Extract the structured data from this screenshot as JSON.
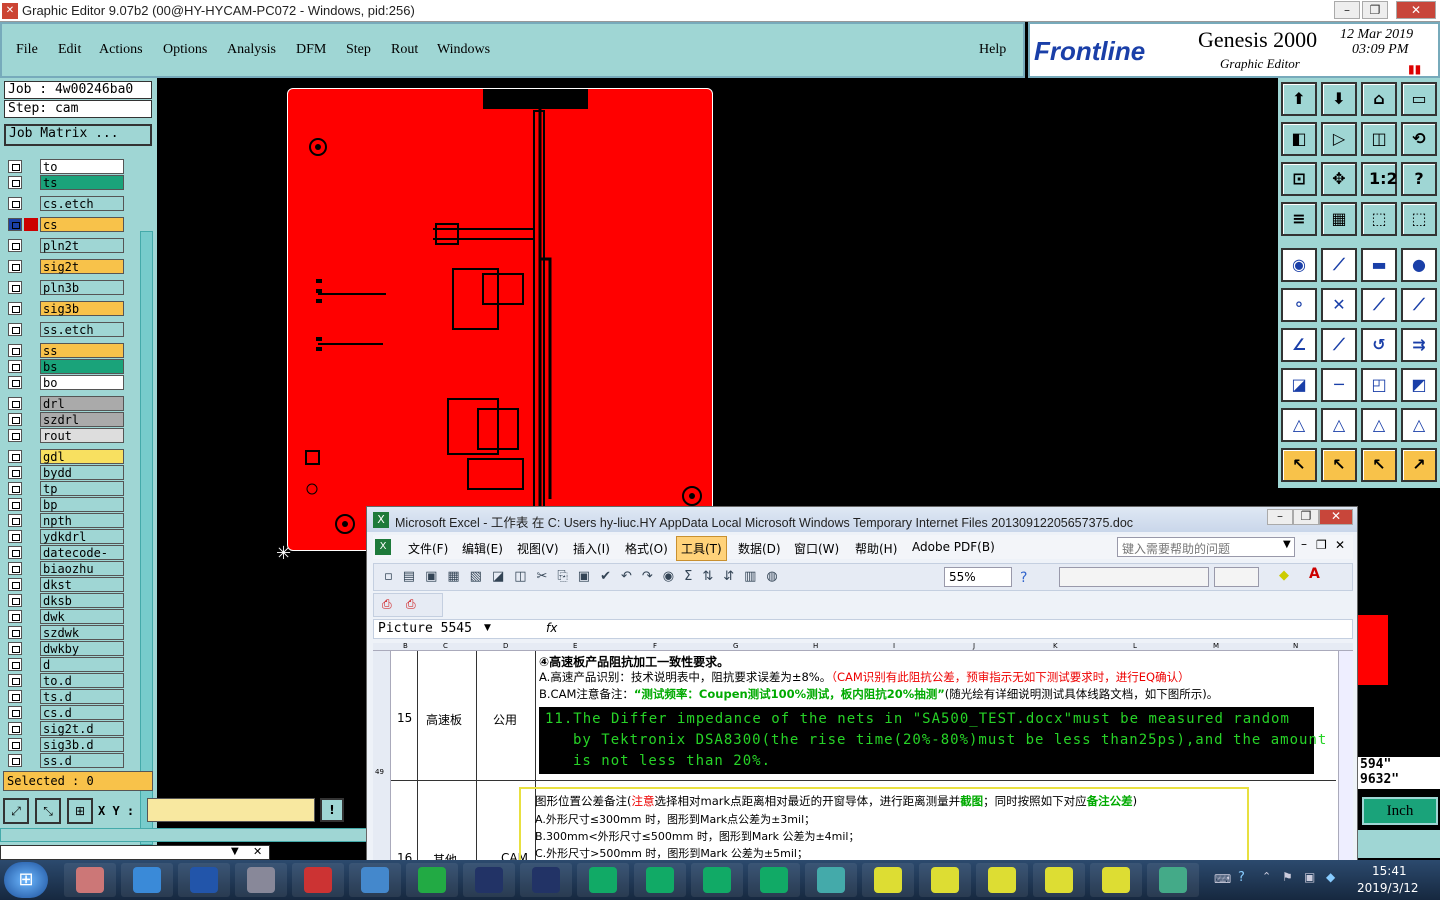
{
  "window": {
    "title": "Graphic Editor 9.07b2 (00@HY-HYCAM-PC072 - Windows, pid:256)"
  },
  "menu": [
    "File",
    "Edit",
    "Actions",
    "Options",
    "Analysis",
    "DFM",
    "Step",
    "Rout",
    "Windows"
  ],
  "help": "Help",
  "brand": {
    "logo": "Frontline",
    "product": "Genesis 2000",
    "subtitle": "Graphic Editor",
    "date": "12 Mar 2019",
    "time": "03:09 PM"
  },
  "job": {
    "job": "Job : 4w00246ba0",
    "step": "Step: cam",
    "matrix": "Job Matrix ..."
  },
  "layers": [
    "to",
    "ts",
    "cs.etch",
    "cs",
    "pln2t",
    "sig2t",
    "pln3b",
    "sig3b",
    "ss.etch",
    "ss",
    "bs",
    "bo",
    "drl",
    "szdrl",
    "rout",
    "gdl",
    "bydd",
    "tp",
    "bp",
    "npth",
    "ydkdrl",
    "datecode-ptc",
    "biaozhu",
    "dkst",
    "dksb",
    "dwk",
    "szdwk",
    "dwkby",
    "d",
    "to.d",
    "ts.d",
    "cs.d",
    "sig2t.d",
    "sig3b.d",
    "ss.d"
  ],
  "selected": "Selected : 0",
  "xy_label": "X Y :",
  "coords": [
    "594\"",
    "9632\""
  ],
  "units": "Inch",
  "excel": {
    "title": "Microsoft Excel - 工作表 在 C: Users hy-liuc.HY AppData Local Microsoft Windows Temporary Internet Files 20130912205657375.doc",
    "menu": [
      "文件(F)",
      "编辑(E)",
      "视图(V)",
      "插入(I)",
      "格式(O)",
      "工具(T)",
      "数据(D)",
      "窗口(W)",
      "帮助(H)",
      "Adobe PDF(B)"
    ],
    "help_placeholder": "键入需要帮助的问题",
    "zoom": "55%",
    "namebox": "Picture 5545",
    "fx": "fx",
    "cols": [
      "B",
      "C",
      "D",
      "E",
      "F",
      "G",
      "H",
      "I",
      "J",
      "K",
      "L",
      "M",
      "N"
    ],
    "row15": {
      "num": "15",
      "type": "高速板",
      "scope": "公用",
      "l1": "④高速板产品阻抗加工一致性要求。",
      "l2a": "A.高速产品识别：技术说明表中，阻抗要求误差为±8%。",
      "l2b": "（CAM识别有此阻抗公差，预审指示无如下测试要求时，进行EQ确认）",
      "l3a": "B.CAM注意备注：",
      "l3b": "“测试频率：Coupen测试100%测试，板内阻抗20%抽测”",
      "l3c": "(随光绘有详细说明测试具体线路文档，如下图所示)。",
      "note": [
        "11.The Differ impedance of the nets in \"SA500_TEST.docx\"must be measured random",
        "by Tektronix DSA8300(the rise time(20%-80%)must be less than25ps),and the amount",
        "is not less than 20%."
      ]
    },
    "row49": "49",
    "row16": {
      "num": "16",
      "type": "其他",
      "scope": "CAM",
      "l1a": "图形位置公差备注(",
      "l1b": "注意",
      "l1c": "选择相对mark点距离相对最近的开窗导体，进行距离测量并",
      "l1d": "截图",
      "l1e": "；同时按照如下对应",
      "l1f": "备注公差",
      "l1g": ")",
      "a": "A.外形尺寸≤300mm 时，图形到Mark点公差为±3mil；",
      "b": "B.300mm<外形尺寸≤500mm 时，图形到Mark 公差为±4mil；",
      "c": "C.外形尺寸>500mm 时，图形到Mark 公差为±5mil；"
    }
  },
  "clock": {
    "time": "15:41",
    "date": "2019/3/12"
  },
  "colors": {
    "teal": "#9fd6d4",
    "board": "#ff0000",
    "orange": "#f8c24a",
    "green": "#1aa37a"
  }
}
